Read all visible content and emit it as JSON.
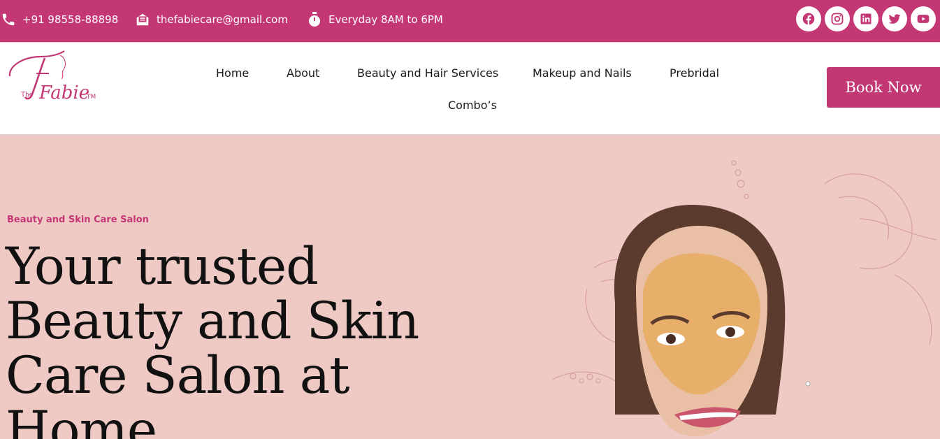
{
  "topbar": {
    "phone": "+91 98558-88898",
    "email": "thefabiecare@gmail.com",
    "hours": "Everyday 8AM to 6PM",
    "socials": [
      "facebook-icon",
      "instagram-icon",
      "linkedin-icon",
      "twitter-icon",
      "youtube-icon"
    ]
  },
  "colors": {
    "brand": "#c43775",
    "hero_bg": "#efcac5"
  },
  "logo": {
    "text": "Fabie",
    "prefix": "The",
    "mark": "TM"
  },
  "nav": {
    "items": [
      "Home",
      "About",
      "Beauty and Hair Services",
      "Makeup and Nails",
      "Prebridal",
      "Combo’s"
    ]
  },
  "cta": {
    "book_label": "Book Now"
  },
  "hero": {
    "eyebrow": "Beauty and Skin Care Salon",
    "headline_lines": [
      "Your trusted",
      "Beauty and Skin",
      "Care Salon at",
      "Home"
    ]
  }
}
